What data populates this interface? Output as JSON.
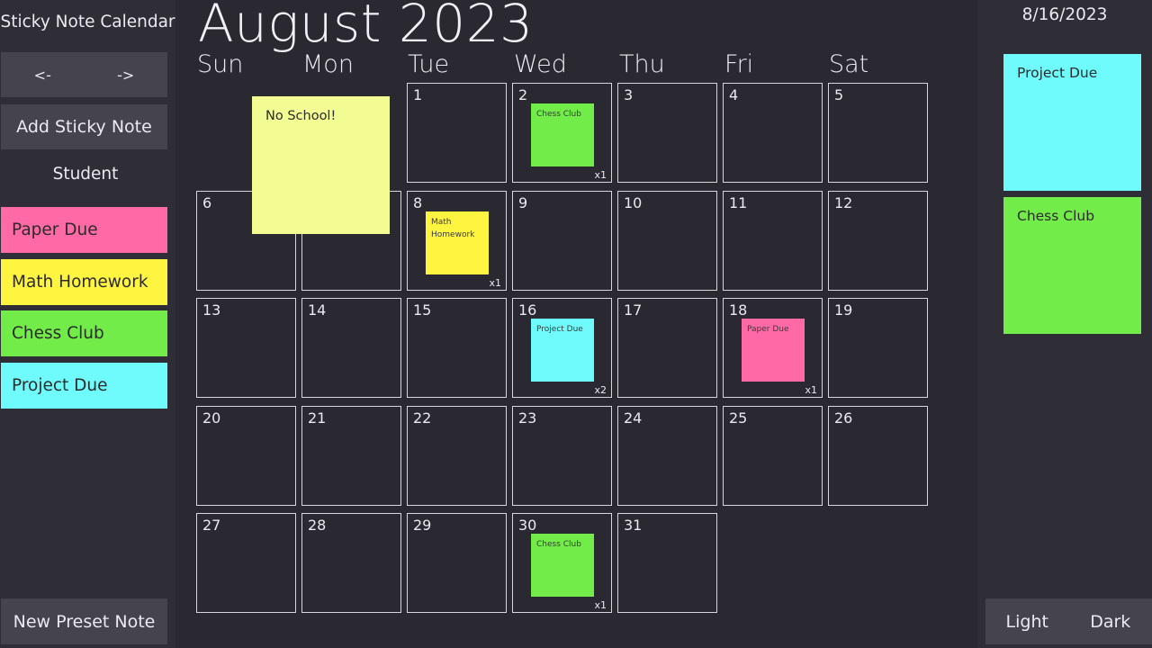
{
  "app": {
    "title": "Sticky Note Calendar"
  },
  "nav": {
    "prev_label": "<-",
    "next_label": "->"
  },
  "sidebar": {
    "add_button": "Add Sticky Note",
    "preset_heading": "Student",
    "presets": [
      {
        "label": "Paper Due",
        "color": "#ff6aa6"
      },
      {
        "label": "Math Homework",
        "color": "#fff541"
      },
      {
        "label": "Chess Club",
        "color": "#72ec48"
      },
      {
        "label": "Project Due",
        "color": "#6ffbfb"
      }
    ],
    "new_preset_button": "New Preset Note"
  },
  "calendar": {
    "month_title": "August 2023",
    "weekdays": [
      "Sun",
      "Mon",
      "Tue",
      "Wed",
      "Thu",
      "Fri",
      "Sat"
    ],
    "first_weekday_index": 2,
    "days_in_month": 31,
    "day_notes": {
      "2": {
        "label": "Chess Club",
        "color": "#72ec48",
        "count": "x1"
      },
      "8": {
        "label": "Math Homework",
        "color": "#fff541",
        "count": "x1"
      },
      "16": {
        "label": "Project Due",
        "color": "#6ffbfb",
        "count": "x2"
      },
      "18": {
        "label": "Paper Due",
        "color": "#ff6aa6",
        "count": "x1"
      },
      "30": {
        "label": "Chess Club",
        "color": "#72ec48",
        "count": "x1"
      }
    },
    "floating_note": {
      "text": "No School!",
      "color": "#f3fb93"
    }
  },
  "detail_panel": {
    "date": "8/16/2023",
    "notes": [
      {
        "label": "Project Due",
        "color": "#6ffbfb"
      },
      {
        "label": "Chess Club",
        "color": "#72ec48"
      }
    ]
  },
  "theme": {
    "light_label": "Light",
    "dark_label": "Dark"
  }
}
